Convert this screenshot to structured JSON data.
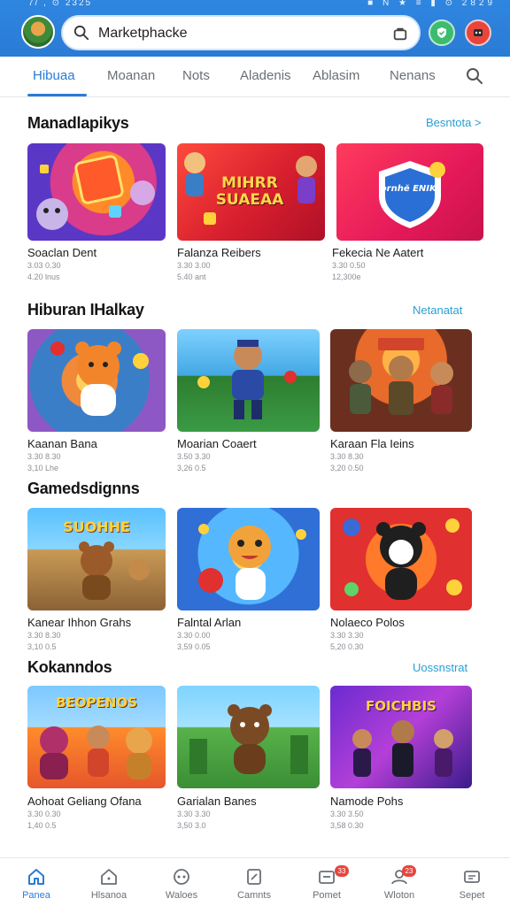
{
  "status_bar": {
    "left": "7/ ,  ⊙ 2325",
    "right": "■ N ★ ≡ ▮ ⊙ 2829"
  },
  "header": {
    "search_text": "Marketphacke",
    "icons": [
      "search-icon",
      "bag-icon",
      "green-action-icon",
      "red-action-icon"
    ]
  },
  "tabs": [
    "Hibuaa",
    "Moanan",
    "Nots",
    "Aladenis",
    "Ablasim",
    "Nenans"
  ],
  "sections": [
    {
      "title": "Manadlapikys",
      "link": "Besntota >",
      "cards": [
        {
          "title": "Soaclan Dent",
          "meta1": "3.03 0.30",
          "meta2": "4.20 lnus",
          "art_text": ""
        },
        {
          "title": "Falanza Reibers",
          "meta1": "3.30 3.00",
          "meta2": "5.40 ant",
          "art_text": "MIHRR SUAEAA"
        },
        {
          "title": "Fekecia Ne Aatert",
          "meta1": "3.30 0.50",
          "meta2": "12,300e",
          "art_text": "prnhĕ ENIKI"
        }
      ]
    },
    {
      "title": "Hiburan IHalkay",
      "link": "Netanatat",
      "cards": [
        {
          "title": "Kaanan Bana",
          "meta1": "3.30 8.30",
          "meta2": "3,10 Lhe",
          "art_text": ""
        },
        {
          "title": "Moarian Coaert",
          "meta1": "3.50 3.30",
          "meta2": "3,26 0.5",
          "art_text": ""
        },
        {
          "title": "Karaan Fla Ieins",
          "meta1": "3.30 8.30",
          "meta2": "3,20 0.50",
          "art_text": ""
        }
      ]
    },
    {
      "title": "Gamedsdignns",
      "link": "",
      "cards": [
        {
          "title": "Kanear Ihhon Grahs",
          "meta1": "3.30 8.30",
          "meta2": "3,10 0.5",
          "art_text": "SUOHHE"
        },
        {
          "title": "Falntal Arlan",
          "meta1": "3.30 0.00",
          "meta2": "3,59 0.05",
          "art_text": ""
        },
        {
          "title": "Nolaeco Polos",
          "meta1": "3.30 3.30",
          "meta2": "5,20 0.30",
          "art_text": ""
        }
      ]
    },
    {
      "title": "Kokanndos",
      "link": "Uossnstrat",
      "cards": [
        {
          "title": "Aohoat Geliang Ofana",
          "meta1": "3.30 0.30",
          "meta2": "1,40 0.5",
          "art_text": "BEOPENOS"
        },
        {
          "title": "Garialan Banes",
          "meta1": "3.30 3.30",
          "meta2": "3,50 3.0",
          "art_text": ""
        },
        {
          "title": "Namode Pohs",
          "meta1": "3.30 3.50",
          "meta2": "3,58 0.30",
          "art_text": "FOICHBIS"
        }
      ]
    }
  ],
  "bottom_nav": [
    {
      "label": "Panea",
      "icon": "home-icon"
    },
    {
      "label": "Hlsanoa",
      "icon": "house-outline-icon"
    },
    {
      "label": "Waloes",
      "icon": "game-controller-icon"
    },
    {
      "label": "Camnts",
      "icon": "tag-icon"
    },
    {
      "label": "Pomet",
      "icon": "inbox-icon",
      "badge": "33"
    },
    {
      "label": "Wloton",
      "icon": "profile-icon",
      "badge": "23"
    },
    {
      "label": "Sepet",
      "icon": "settings-card-icon"
    }
  ],
  "colors": {
    "primary": "#2a7bd6",
    "link": "#2a9fd0",
    "badge": "#e8453c"
  }
}
